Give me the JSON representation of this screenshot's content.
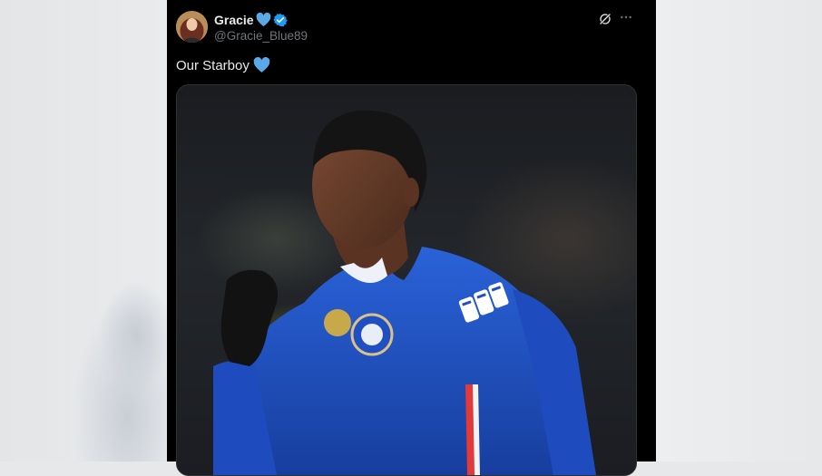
{
  "tweet": {
    "display_name": "Gracie",
    "handle": "@Gracie_Blue89",
    "text": "Our Starboy",
    "name_emoji": "blue-heart-icon",
    "text_emoji": "blue-heart-icon",
    "verified": true,
    "colors": {
      "heart": "#5aa9e6",
      "verified_badge": "#1d9bf0",
      "secondary_text": "#71767b"
    }
  },
  "media": {
    "description": "Footballer in blue Chelsea kit with FPT sleeve sponsor",
    "sleeve_sponsor": "FPT",
    "kit_color": "#1f4fc1"
  },
  "actions": {
    "grok_icon": "grok-icon",
    "more_icon": "more-horizontal-icon"
  }
}
